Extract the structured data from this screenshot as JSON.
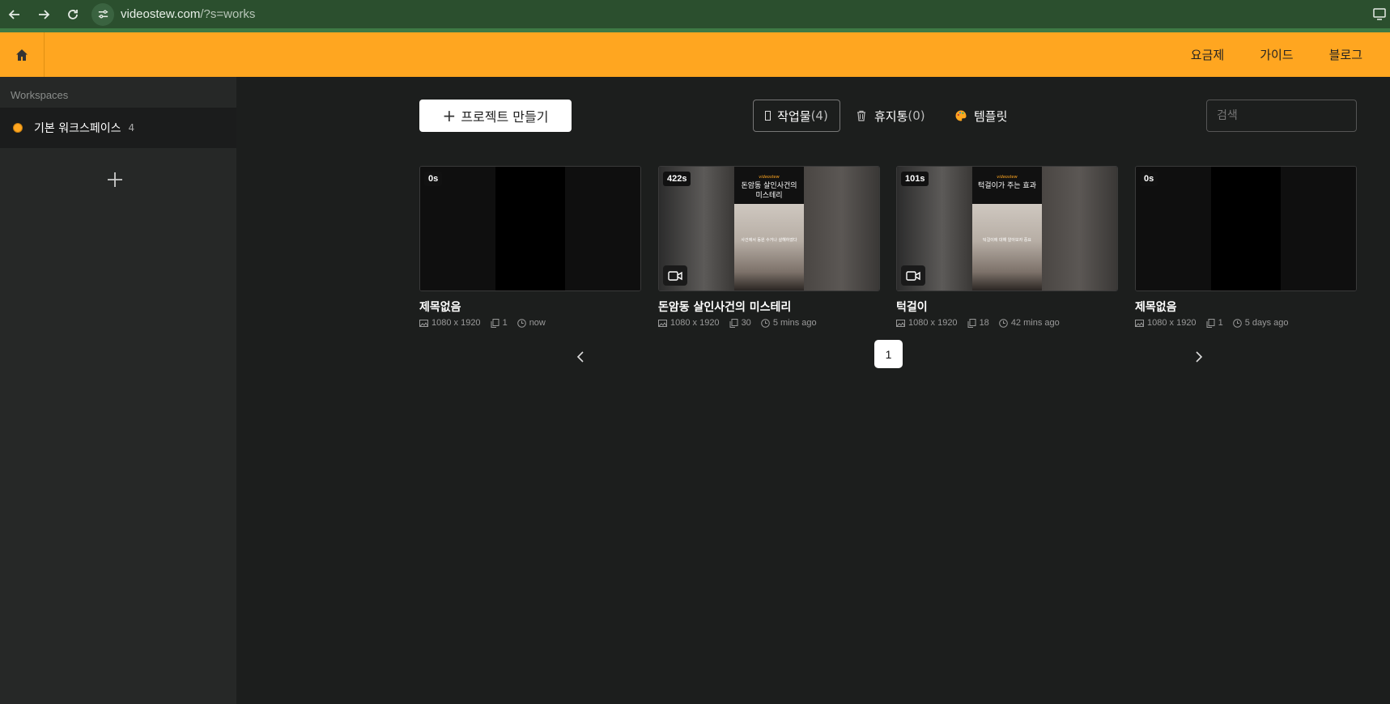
{
  "browser": {
    "url_host": "videostew.com",
    "url_rest": "/?s=works"
  },
  "header": {
    "nav": [
      "요금제",
      "가이드",
      "블로그"
    ]
  },
  "sidebar": {
    "title": "Workspaces",
    "workspace": {
      "name": "기본 워크스페이스",
      "count": "4"
    }
  },
  "toolbar": {
    "create_plus": "+",
    "create_label": "프로젝트 만들기",
    "works_label": "작업물",
    "works_count": "(4)",
    "trash_label": "휴지통",
    "trash_count": "(0)",
    "template_label": "템플릿",
    "search_placeholder": "검색"
  },
  "cards": [
    {
      "duration": "0s",
      "title": "제목없음",
      "resolution": "1080 x 1920",
      "scenes": "1",
      "time": "now",
      "thumb_title": "",
      "thumb_sub": ""
    },
    {
      "duration": "422s",
      "title": "돈암동 살인사건의 미스테리",
      "resolution": "1080 x 1920",
      "scenes": "30",
      "time": "5 mins ago",
      "thumb_title": "돈암동 살인사건의 미스테리",
      "thumb_sub": "사건에서 동원 수거나 살해하였다"
    },
    {
      "duration": "101s",
      "title": "턱걸이",
      "resolution": "1080 x 1920",
      "scenes": "18",
      "time": "42 mins ago",
      "thumb_title": "턱걸이가 주는 효과",
      "thumb_sub": "턱걸이에 대해 알아보자 중요"
    },
    {
      "duration": "0s",
      "title": "제목없음",
      "resolution": "1080 x 1920",
      "scenes": "1",
      "time": "5 days ago",
      "thumb_title": "",
      "thumb_sub": ""
    }
  ],
  "pager": {
    "current": "1"
  },
  "colors": {
    "accent": "#ffa620",
    "browser": "#2b4f2e",
    "sidebar": "#262827",
    "bg": "#1c1e1d"
  }
}
